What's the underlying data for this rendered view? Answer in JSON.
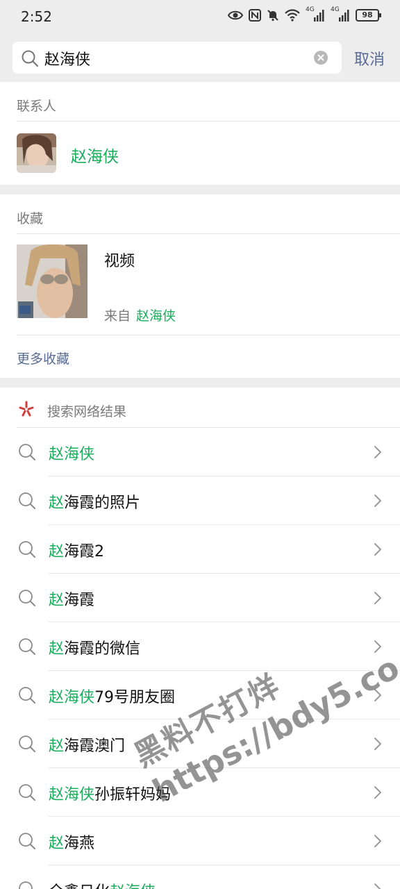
{
  "status_bar": {
    "time": "2:52",
    "battery": "98",
    "signal_label_1": "4G",
    "signal_label_2": "4G"
  },
  "search": {
    "query": "赵海侠",
    "cancel_label": "取消"
  },
  "contacts": {
    "section_title": "联系人",
    "items": [
      {
        "name": "赵海侠"
      }
    ]
  },
  "favorites": {
    "section_title": "收藏",
    "item": {
      "title": "视频",
      "from_prefix": "来自",
      "from_name": "赵海侠"
    },
    "more_label": "更多收藏"
  },
  "web_results": {
    "section_title": "搜索网络结果",
    "items": [
      {
        "highlight": "赵海侠",
        "rest": "",
        "tail": ""
      },
      {
        "highlight": "赵",
        "rest": "海霞的照片",
        "tail": ""
      },
      {
        "highlight": "赵",
        "rest": "海霞2",
        "tail": ""
      },
      {
        "highlight": "赵",
        "rest": "海霞",
        "tail": ""
      },
      {
        "highlight": "赵",
        "rest": "海霞的微信",
        "tail": ""
      },
      {
        "highlight": "赵海侠",
        "rest": "79号朋友圈",
        "tail": ""
      },
      {
        "highlight": "赵",
        "rest": "海霞澳门",
        "tail": ""
      },
      {
        "highlight": "赵海侠",
        "rest": "孙振轩妈妈",
        "tail": ""
      },
      {
        "highlight": "赵",
        "rest": "海燕",
        "tail": ""
      },
      {
        "highlight": "",
        "rest": "全鑫日化",
        "tail": "赵海侠"
      }
    ]
  },
  "watermark": {
    "line1": "黑料不打烊",
    "line2": "https://bdy5.co"
  },
  "colors": {
    "highlight_green": "#1aad5c",
    "link_blue": "#576b95",
    "background": "#ededed"
  }
}
